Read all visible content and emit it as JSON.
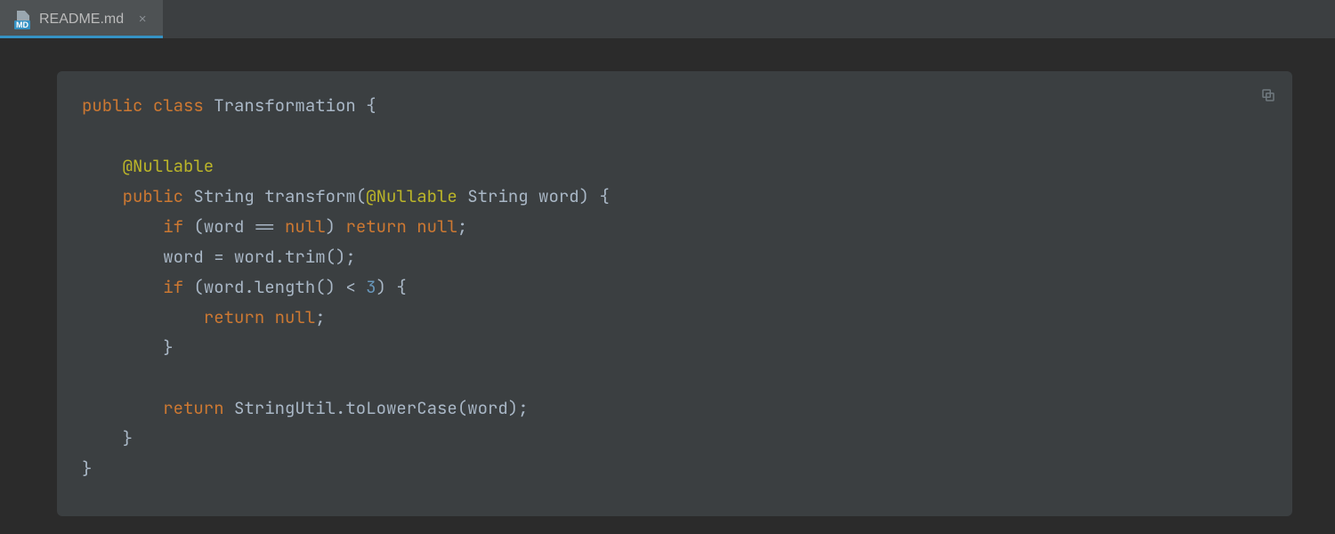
{
  "tabs": [
    {
      "label": "README.md",
      "icon_badge": "MD",
      "active": true
    }
  ],
  "code": {
    "tokens": [
      [
        {
          "t": "public",
          "c": "keyword"
        },
        {
          "t": " ",
          "c": "punc"
        },
        {
          "t": "class",
          "c": "keyword"
        },
        {
          "t": " ",
          "c": "punc"
        },
        {
          "t": "Transformation {",
          "c": "type"
        }
      ],
      [],
      [
        {
          "t": "    ",
          "c": "punc"
        },
        {
          "t": "@Nullable",
          "c": "annot"
        }
      ],
      [
        {
          "t": "    ",
          "c": "punc"
        },
        {
          "t": "public",
          "c": "keyword"
        },
        {
          "t": " ",
          "c": "punc"
        },
        {
          "t": "String transform(",
          "c": "type"
        },
        {
          "t": "@Nullable",
          "c": "annot"
        },
        {
          "t": " String word) {",
          "c": "type"
        }
      ],
      [
        {
          "t": "        ",
          "c": "punc"
        },
        {
          "t": "if",
          "c": "keyword"
        },
        {
          "t": " (word == ",
          "c": "ident"
        },
        {
          "t": "null",
          "c": "keyword"
        },
        {
          "t": ") ",
          "c": "ident"
        },
        {
          "t": "return",
          "c": "keyword"
        },
        {
          "t": " ",
          "c": "ident"
        },
        {
          "t": "null",
          "c": "keyword"
        },
        {
          "t": ";",
          "c": "punc"
        }
      ],
      [
        {
          "t": "        ",
          "c": "punc"
        },
        {
          "t": "word = word.trim();",
          "c": "ident"
        }
      ],
      [
        {
          "t": "        ",
          "c": "punc"
        },
        {
          "t": "if",
          "c": "keyword"
        },
        {
          "t": " (word.length() < ",
          "c": "ident"
        },
        {
          "t": "3",
          "c": "num"
        },
        {
          "t": ") {",
          "c": "ident"
        }
      ],
      [
        {
          "t": "            ",
          "c": "punc"
        },
        {
          "t": "return",
          "c": "keyword"
        },
        {
          "t": " ",
          "c": "ident"
        },
        {
          "t": "null",
          "c": "keyword"
        },
        {
          "t": ";",
          "c": "punc"
        }
      ],
      [
        {
          "t": "        }",
          "c": "ident"
        }
      ],
      [],
      [
        {
          "t": "        ",
          "c": "punc"
        },
        {
          "t": "return",
          "c": "keyword"
        },
        {
          "t": " StringUtil.toLowerCase(word);",
          "c": "ident"
        }
      ],
      [
        {
          "t": "    }",
          "c": "ident"
        }
      ],
      [
        {
          "t": "}",
          "c": "ident"
        }
      ]
    ]
  }
}
